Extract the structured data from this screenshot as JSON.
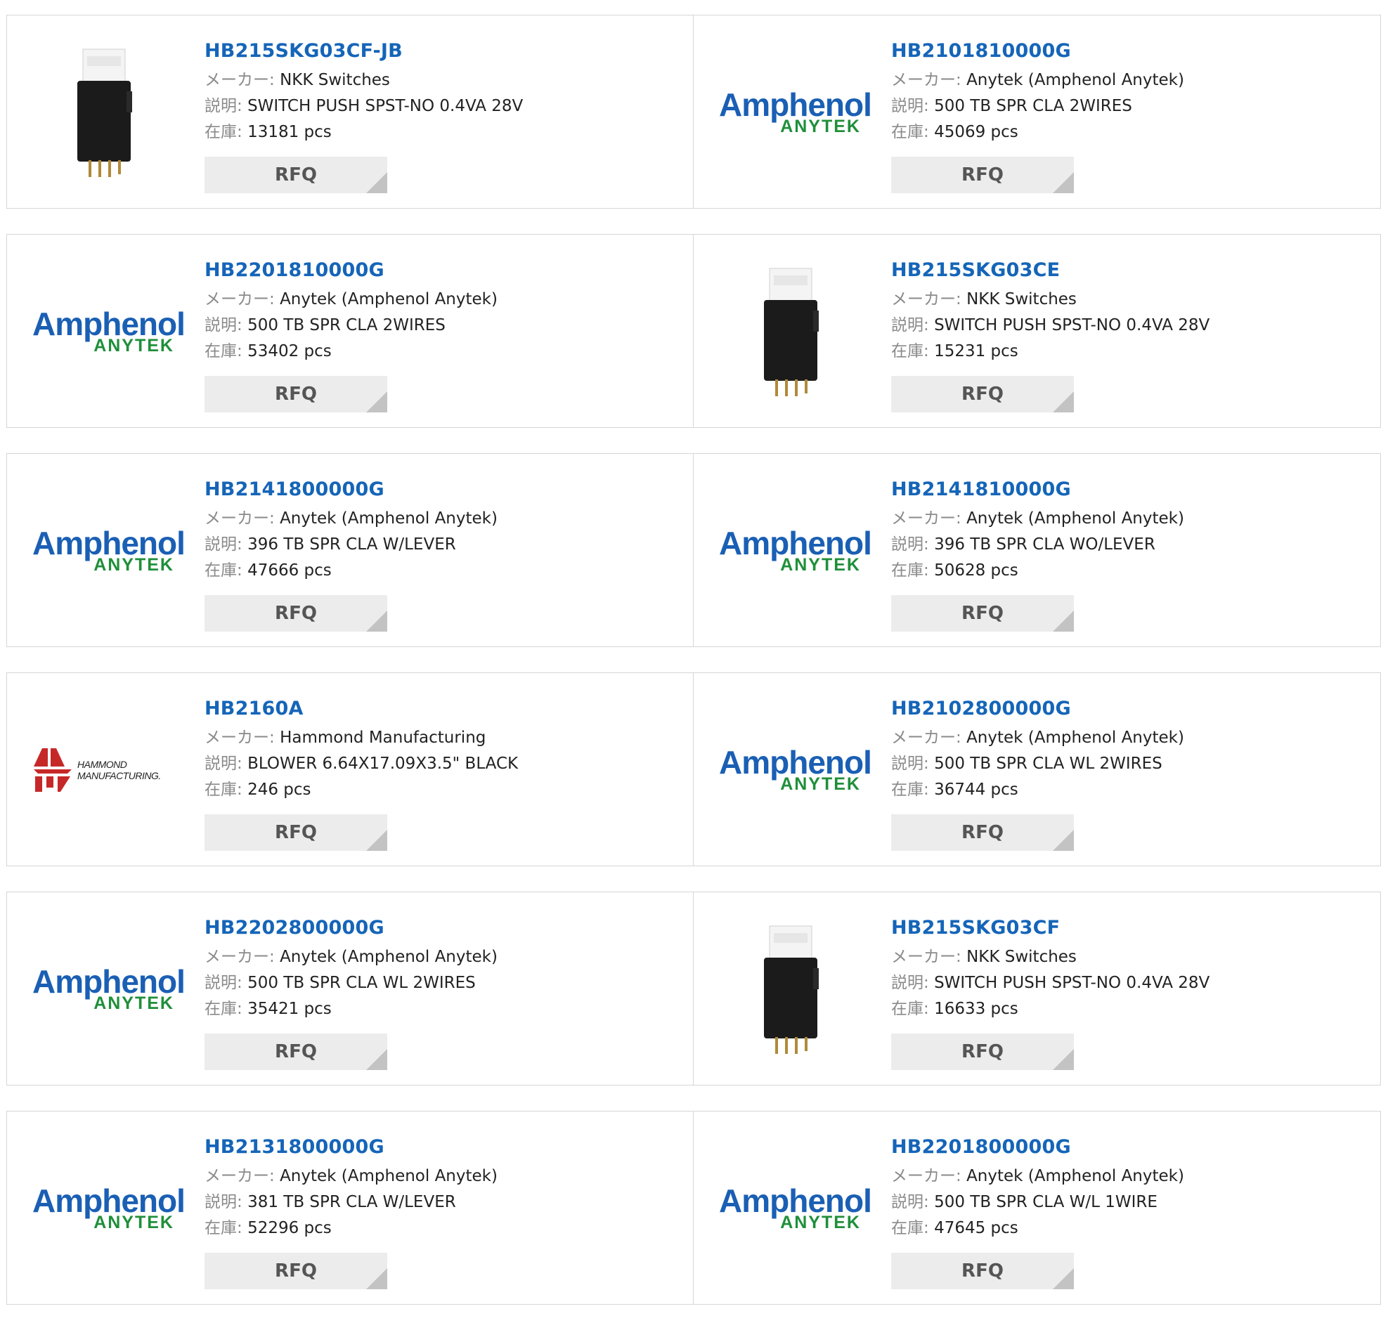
{
  "labels": {
    "maker": "メーカー:",
    "desc": "説明:",
    "stock": "在庫:",
    "rfq": "RFQ"
  },
  "colors": {
    "part_link": "#1565b8",
    "amphenol_blue": "#1a5fb4",
    "anytek_green": "#1f8f3a",
    "hammond_red": "#c62828",
    "rfq_bg": "#ececec"
  },
  "logos": {
    "amphenol_top": "Amphenol",
    "amphenol_bottom": "ANYTEK",
    "hammond_line1": "HAMMOND",
    "hammond_line2": "MANUFACTURING."
  },
  "products": [
    {
      "part": "HB215SKG03CF-JB",
      "maker": "NKK Switches",
      "desc": "SWITCH PUSH SPST-NO 0.4VA 28V",
      "stock": "13181 pcs",
      "image": "push-switch-photo"
    },
    {
      "part": "HB2101810000G",
      "maker": "Anytek (Amphenol Anytek)",
      "desc": "500 TB SPR CLA 2WIRES",
      "stock": "45069 pcs",
      "image": "amphenol-logo"
    },
    {
      "part": "HB2201810000G",
      "maker": "Anytek (Amphenol Anytek)",
      "desc": "500 TB SPR CLA 2WIRES",
      "stock": "53402 pcs",
      "image": "amphenol-logo"
    },
    {
      "part": "HB215SKG03CE",
      "maker": "NKK Switches",
      "desc": "SWITCH PUSH SPST-NO 0.4VA 28V",
      "stock": "15231 pcs",
      "image": "push-switch-photo"
    },
    {
      "part": "HB2141800000G",
      "maker": "Anytek (Amphenol Anytek)",
      "desc": "396 TB SPR CLA W/LEVER",
      "stock": "47666 pcs",
      "image": "amphenol-logo"
    },
    {
      "part": "HB2141810000G",
      "maker": "Anytek (Amphenol Anytek)",
      "desc": "396 TB SPR CLA WO/LEVER",
      "stock": "50628 pcs",
      "image": "amphenol-logo"
    },
    {
      "part": "HB2160A",
      "maker": "Hammond Manufacturing",
      "desc": "BLOWER 6.64X17.09X3.5\" BLACK",
      "stock": "246 pcs",
      "image": "hammond-logo"
    },
    {
      "part": "HB2102800000G",
      "maker": "Anytek (Amphenol Anytek)",
      "desc": "500 TB SPR CLA WL 2WIRES",
      "stock": "36744 pcs",
      "image": "amphenol-logo"
    },
    {
      "part": "HB2202800000G",
      "maker": "Anytek (Amphenol Anytek)",
      "desc": "500 TB SPR CLA WL 2WIRES",
      "stock": "35421 pcs",
      "image": "amphenol-logo"
    },
    {
      "part": "HB215SKG03CF",
      "maker": "NKK Switches",
      "desc": "SWITCH PUSH SPST-NO 0.4VA 28V",
      "stock": "16633 pcs",
      "image": "push-switch-photo"
    },
    {
      "part": "HB2131800000G",
      "maker": "Anytek (Amphenol Anytek)",
      "desc": "381 TB SPR CLA W/LEVER",
      "stock": "52296 pcs",
      "image": "amphenol-logo"
    },
    {
      "part": "HB2201800000G",
      "maker": "Anytek (Amphenol Anytek)",
      "desc": "500 TB SPR CLA W/L 1WIRE",
      "stock": "47645 pcs",
      "image": "amphenol-logo"
    }
  ]
}
